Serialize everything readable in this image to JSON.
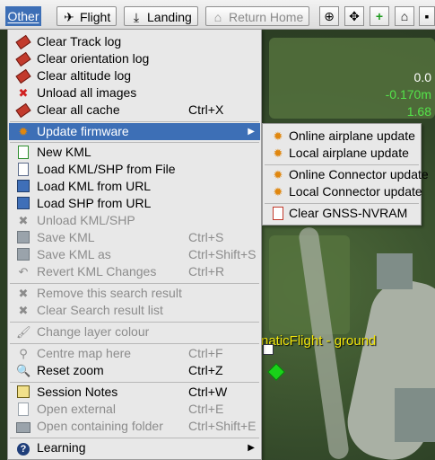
{
  "toolbar": {
    "menu_label": "Other",
    "buttons": [
      {
        "label": "Flight",
        "icon": "flight-icon",
        "enabled": true
      },
      {
        "label": "Landing",
        "icon": "landing-icon",
        "enabled": true
      },
      {
        "label": "Return Home",
        "icon": "return-home-icon",
        "enabled": false
      }
    ],
    "icon_buttons": [
      "zoom-fit-icon",
      "center-icon",
      "add-icon",
      "home-icon",
      "clip-icon"
    ]
  },
  "hud": {
    "value1": "0.0",
    "value2": "-0.170m",
    "value3": "1.68"
  },
  "map_label": "naticFlight - ground",
  "menu": {
    "items": [
      {
        "label": "Clear Track log",
        "icon": "eraser-icon",
        "shortcut": "",
        "enabled": true
      },
      {
        "label": "Clear orientation log",
        "icon": "eraser-icon",
        "shortcut": "",
        "enabled": true
      },
      {
        "label": "Clear altitude log",
        "icon": "eraser-icon",
        "shortcut": "",
        "enabled": true
      },
      {
        "label": "Unload all images",
        "icon": "x-icon",
        "shortcut": "",
        "enabled": true
      },
      {
        "label": "Clear all cache",
        "icon": "eraser-icon",
        "shortcut": "Ctrl+X",
        "enabled": true
      },
      {
        "label": "Update firmware",
        "icon": "gear-icon",
        "shortcut": "",
        "enabled": true,
        "submenu": true
      },
      {
        "label": "New KML",
        "icon": "new-document-icon",
        "shortcut": "",
        "enabled": true
      },
      {
        "label": "Load KML/SHP from File",
        "icon": "document-icon",
        "shortcut": "",
        "enabled": true
      },
      {
        "label": "Load KML from URL",
        "icon": "floppy-icon",
        "shortcut": "",
        "enabled": true
      },
      {
        "label": "Load SHP from URL",
        "icon": "floppy-icon",
        "shortcut": "",
        "enabled": true
      },
      {
        "label": "Unload KML/SHP",
        "icon": "x-icon",
        "shortcut": "",
        "enabled": false
      },
      {
        "label": "Save KML",
        "icon": "floppy-icon",
        "shortcut": "Ctrl+S",
        "enabled": false
      },
      {
        "label": "Save KML as",
        "icon": "floppy-icon",
        "shortcut": "Ctrl+Shift+S",
        "enabled": false
      },
      {
        "label": "Revert KML Changes",
        "icon": "revert-icon",
        "shortcut": "Ctrl+R",
        "enabled": false
      },
      {
        "label": "Remove this search result",
        "icon": "x-icon",
        "shortcut": "",
        "enabled": false
      },
      {
        "label": "Clear Search result list",
        "icon": "x-icon",
        "shortcut": "",
        "enabled": false
      },
      {
        "label": "Change layer colour",
        "icon": "paint-icon",
        "shortcut": "",
        "enabled": false
      },
      {
        "label": "Centre map here",
        "icon": "pin-icon",
        "shortcut": "Ctrl+F",
        "enabled": false
      },
      {
        "label": "Reset zoom",
        "icon": "magnifier-icon",
        "shortcut": "Ctrl+Z",
        "enabled": true
      },
      {
        "label": "Session Notes",
        "icon": "note-icon",
        "shortcut": "Ctrl+W",
        "enabled": true
      },
      {
        "label": "Open external",
        "icon": "document-icon",
        "shortcut": "Ctrl+E",
        "enabled": false
      },
      {
        "label": "Open containing folder",
        "icon": "folder-icon",
        "shortcut": "Ctrl+Shift+E",
        "enabled": false
      },
      {
        "label": "Learning",
        "icon": "help-icon",
        "shortcut": "",
        "enabled": true,
        "submenu": true
      }
    ]
  },
  "submenu": {
    "items": [
      {
        "label": "Online airplane update",
        "icon": "gear-icon"
      },
      {
        "label": "Local airplane update",
        "icon": "gear-icon"
      },
      {
        "label": "Online Connector update",
        "icon": "gear-icon"
      },
      {
        "label": "Local Connector update",
        "icon": "gear-icon"
      },
      {
        "label": "Clear GNSS-NVRAM",
        "icon": "document-clear-icon"
      }
    ]
  },
  "colors": {
    "highlight": "#3d6fb6",
    "map_label": "#f2e60c",
    "hud_green": "#54e34a",
    "menu_bg": "#e8e8e8"
  }
}
